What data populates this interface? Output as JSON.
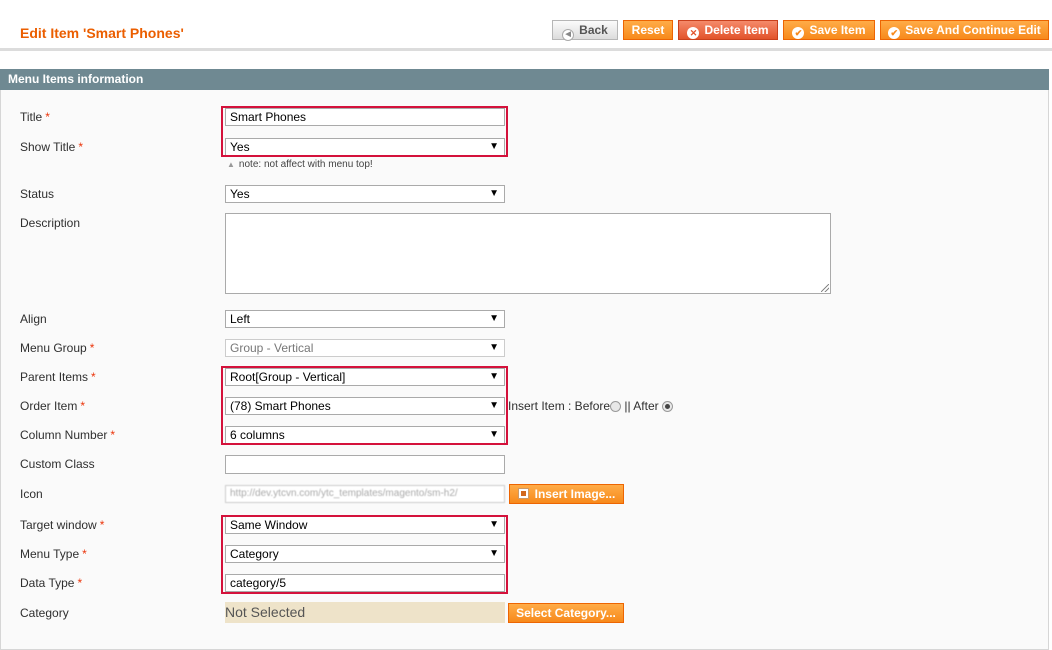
{
  "header": {
    "title": "Edit Item 'Smart Phones'",
    "buttons": {
      "back": "Back",
      "reset": "Reset",
      "delete": "Delete Item",
      "save": "Save Item",
      "save_continue": "Save And Continue Edit"
    }
  },
  "section": {
    "title": "Menu Items information"
  },
  "form": {
    "title": {
      "label": "Title",
      "value": "Smart Phones"
    },
    "show_title": {
      "label": "Show Title",
      "value": "Yes",
      "note": "note: not affect with menu top!"
    },
    "status": {
      "label": "Status",
      "value": "Yes"
    },
    "description": {
      "label": "Description",
      "value": ""
    },
    "align": {
      "label": "Align",
      "value": "Left"
    },
    "menu_group": {
      "label": "Menu Group",
      "value": "Group - Vertical"
    },
    "parent_items": {
      "label": "Parent Items",
      "value": "Root[Group - Vertical]"
    },
    "order_item": {
      "label": "Order Item",
      "value": "(78) Smart Phones",
      "insert_label": "Insert Item : Before",
      "separator": "||",
      "after_label": "After",
      "selected_position": "After"
    },
    "column_number": {
      "label": "Column Number",
      "value": "6 columns"
    },
    "custom_class": {
      "label": "Custom Class",
      "value": ""
    },
    "icon": {
      "label": "Icon",
      "value": "http://dev.ytcvn.com/ytc_templates/magento/sm-h2/",
      "button": "Insert Image..."
    },
    "target_window": {
      "label": "Target window",
      "value": "Same Window"
    },
    "menu_type": {
      "label": "Menu Type",
      "value": "Category"
    },
    "data_type": {
      "label": "Data Type",
      "value": "category/5"
    },
    "category": {
      "label": "Category",
      "value": "Not Selected",
      "button": "Select Category..."
    }
  },
  "required_mark": "*",
  "colors": {
    "accent": "#eb5e00",
    "section_header": "#6f8992",
    "highlight": "#d4113b",
    "button": "#f7891b"
  }
}
